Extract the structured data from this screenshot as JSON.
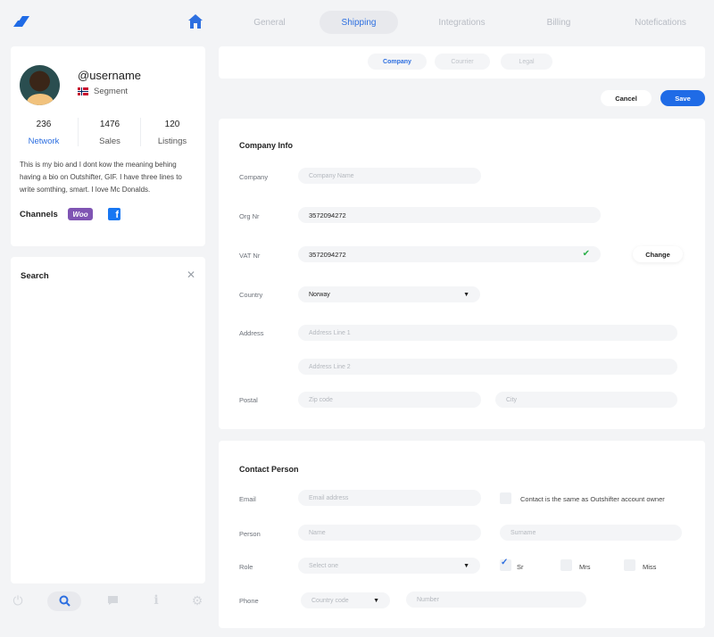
{
  "nav": {
    "tabs": [
      {
        "label": "General",
        "active": false
      },
      {
        "label": "Shipping",
        "active": true
      },
      {
        "label": "Integrations",
        "active": false
      },
      {
        "label": "Billing",
        "active": false
      },
      {
        "label": "Notefications",
        "active": false
      }
    ]
  },
  "profile": {
    "username": "@username",
    "segment": "Segment",
    "stats": [
      {
        "value": "236",
        "label": "Network"
      },
      {
        "value": "1476",
        "label": "Sales"
      },
      {
        "value": "120",
        "label": "Listings"
      }
    ],
    "bio": "This is my bio and I dont kow the meaning behing having a bio on Outshifter, GIF. I have three lines to write somthing, smart. I love Mc Donalds.",
    "channels_label": "Channels",
    "woo_label": "Woo"
  },
  "search": {
    "title": "Search"
  },
  "subtabs": [
    {
      "label": "Company",
      "active": true
    },
    {
      "label": "Courrier",
      "active": false
    },
    {
      "label": "Legal",
      "active": false
    }
  ],
  "actions": {
    "cancel": "Cancel",
    "save": "Save"
  },
  "company_info": {
    "title": "Company Info",
    "company_label": "Company",
    "company_placeholder": "Company Name",
    "org_label": "Org Nr",
    "org_value": "3572094272",
    "vat_label": "VAT Nr",
    "vat_value": "3572094272",
    "change_label": "Change",
    "country_label": "Country",
    "country_value": "Norway",
    "address_label": "Address",
    "address1_placeholder": "Address Line 1",
    "address2_placeholder": "Address Line 2",
    "postal_label": "Postal",
    "zip_placeholder": "Zip code",
    "city_placeholder": "City"
  },
  "contact_person": {
    "title": "Contact Person",
    "email_label": "Email",
    "email_placeholder": "Email address",
    "same_owner_label": "Contact is the same as Outshifter account owner",
    "person_label": "Person",
    "name_placeholder": "Name",
    "surname_placeholder": "Surname",
    "role_label": "Role",
    "role_placeholder": "Select one",
    "titles": [
      {
        "label": "Sr",
        "checked": true
      },
      {
        "label": "Mrs",
        "checked": false
      },
      {
        "label": "Miss",
        "checked": false
      }
    ],
    "phone_label": "Phone",
    "country_code_placeholder": "Country code",
    "number_placeholder": "Number"
  },
  "colors": {
    "accent": "#1f6be6",
    "check": "#2bb04a"
  }
}
